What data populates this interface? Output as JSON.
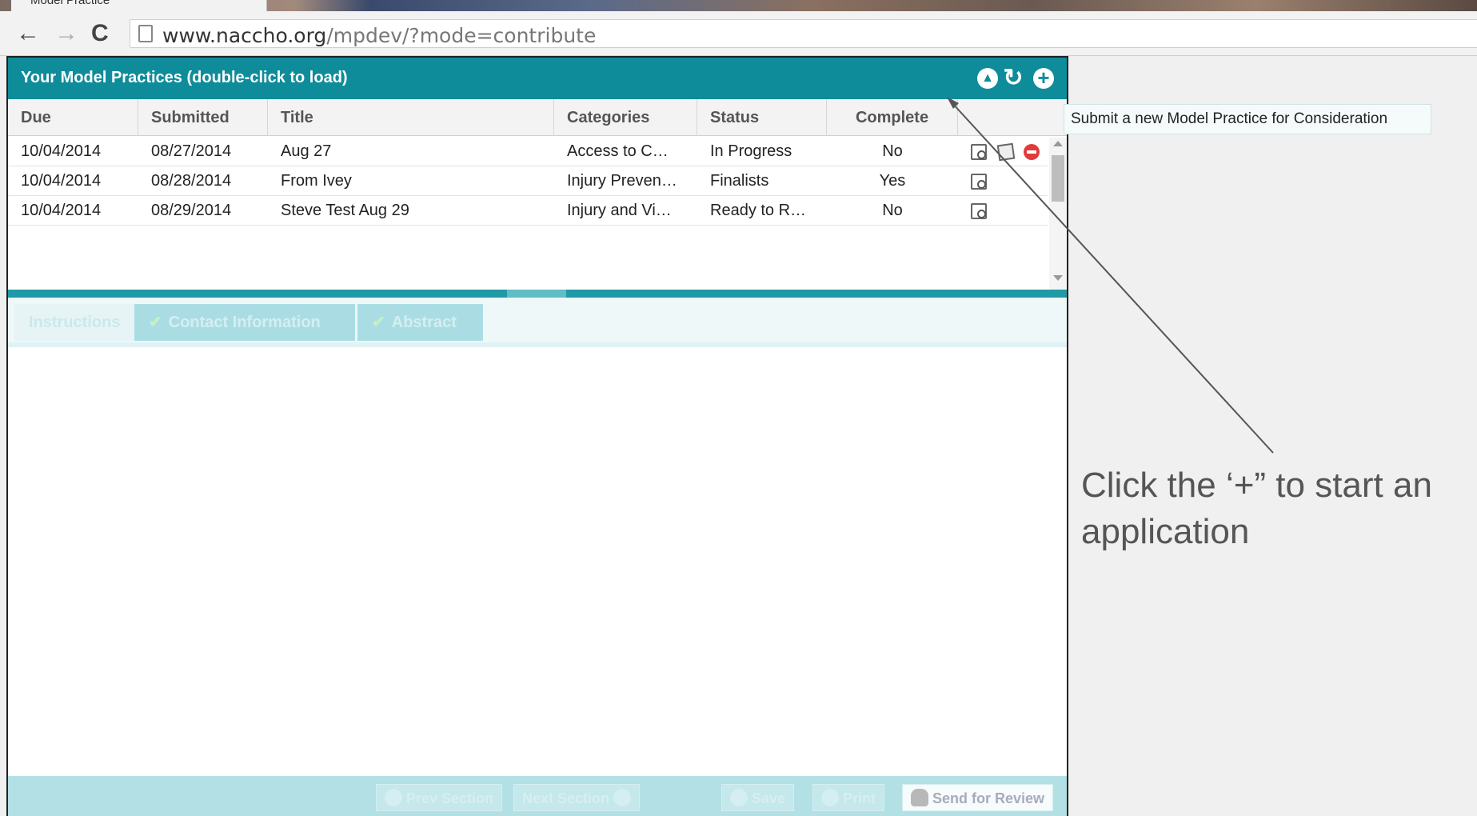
{
  "browser": {
    "tab_title": "Model Practice",
    "url_domain": "www.naccho.org",
    "url_path": "/mpdev/?mode=contribute",
    "back_icon": "←",
    "forward_icon": "→",
    "reload_icon": "C"
  },
  "panel": {
    "title": "Your Model Practices (double-click to load)",
    "header_icons": [
      "collapse-icon",
      "refresh-icon",
      "add-icon"
    ],
    "columns": [
      "Due",
      "Submitted",
      "Title",
      "Categories",
      "Status",
      "Complete"
    ],
    "rows": [
      {
        "due": "10/04/2014",
        "submitted": "08/27/2014",
        "title": "Aug 27",
        "categories": "Access to C…",
        "status": "In Progress",
        "complete": "No",
        "actions": [
          "view",
          "edit",
          "delete"
        ]
      },
      {
        "due": "10/04/2014",
        "submitted": "08/28/2014",
        "title": "From Ivey",
        "categories": "Injury Preven…",
        "status": "Finalists",
        "complete": "Yes",
        "actions": [
          "view"
        ]
      },
      {
        "due": "10/04/2014",
        "submitted": "08/29/2014",
        "title": "Steve Test Aug 29",
        "categories": "Injury and Vi…",
        "status": "Ready to R…",
        "complete": "No",
        "actions": [
          "view"
        ]
      }
    ]
  },
  "section_tabs": [
    "Instructions",
    "Contact Information",
    "Abstract"
  ],
  "footer": {
    "prev": "Prev Section",
    "next": "Next Section",
    "save": "Save",
    "print": "Print",
    "send": "Send for Review"
  },
  "tooltip": "Submit a new Model Practice for Consideration",
  "callout": "Click the ‘+” to start an application",
  "colors": {
    "header": "#0f8c9a",
    "accent": "#1f9aa6"
  }
}
